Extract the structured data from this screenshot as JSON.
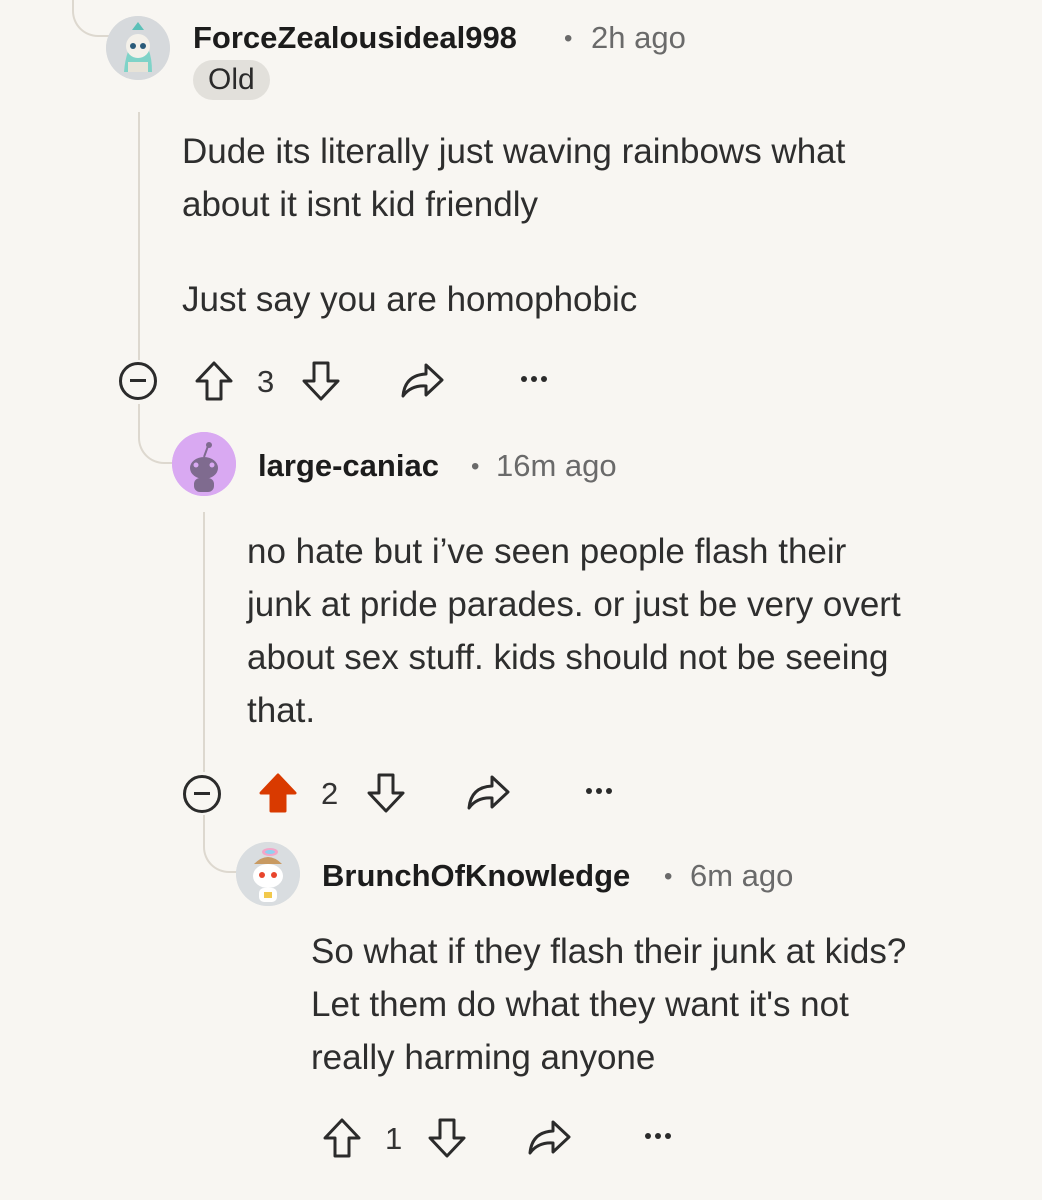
{
  "comments": [
    {
      "username": "ForceZealousideal998",
      "time": "2h ago",
      "separator": "•",
      "flair": "Old",
      "body_lines": [
        "Dude its literally just waving rainbows what",
        "about it isnt kid friendly",
        "",
        "Just say you are homophobic"
      ],
      "score": "3",
      "upvoted": false,
      "avatar": "snoo-avatar-teal-character"
    },
    {
      "username": "large-caniac",
      "time": "16m ago",
      "separator": "•",
      "body_lines": [
        "no hate but i’ve seen people flash their",
        "junk at pride parades. or just be very overt",
        "about sex stuff. kids should not be seeing",
        "that."
      ],
      "score": "2",
      "upvoted": true,
      "avatar": "default-snoo-purple"
    },
    {
      "username": "BrunchOfKnowledge",
      "time": "6m ago",
      "separator": "•",
      "body_lines": [
        "So what if they flash their junk at kids?",
        "Let them do what they want it's not",
        "really harming anyone"
      ],
      "score": "1",
      "upvoted": false,
      "avatar": "snoo-avatar-pride-hat"
    }
  ],
  "icons": {
    "upvote": "upvote-arrow-icon",
    "downvote": "downvote-arrow-icon",
    "share": "share-icon",
    "more": "more-options-icon",
    "collapse": "collapse-thread-icon"
  },
  "colors": {
    "background": "#f8f6f2",
    "upvote_active": "#d93a00",
    "thread_line": "#ddd8cf",
    "meta_text": "#6a6a6a"
  }
}
